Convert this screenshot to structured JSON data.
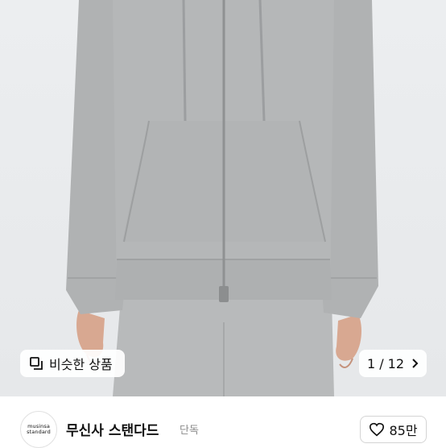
{
  "product_image": {
    "alt_icon": "product-photo"
  },
  "similar_products": {
    "icon": "similar-items-icon",
    "label": "비슷한 상품"
  },
  "gallery": {
    "counter": "1 / 12",
    "next_icon": "chevron-right-icon"
  },
  "brand": {
    "logo_line1": "musinsa",
    "logo_line2": "standard",
    "name": "무신사 스탠다드",
    "tag": "단독"
  },
  "like": {
    "icon": "heart-icon",
    "count": "85만"
  },
  "colors": {
    "background": "#e8eaec",
    "garment": "#b3b5b6",
    "text": "#111111",
    "tag": "#8a8a8a"
  }
}
